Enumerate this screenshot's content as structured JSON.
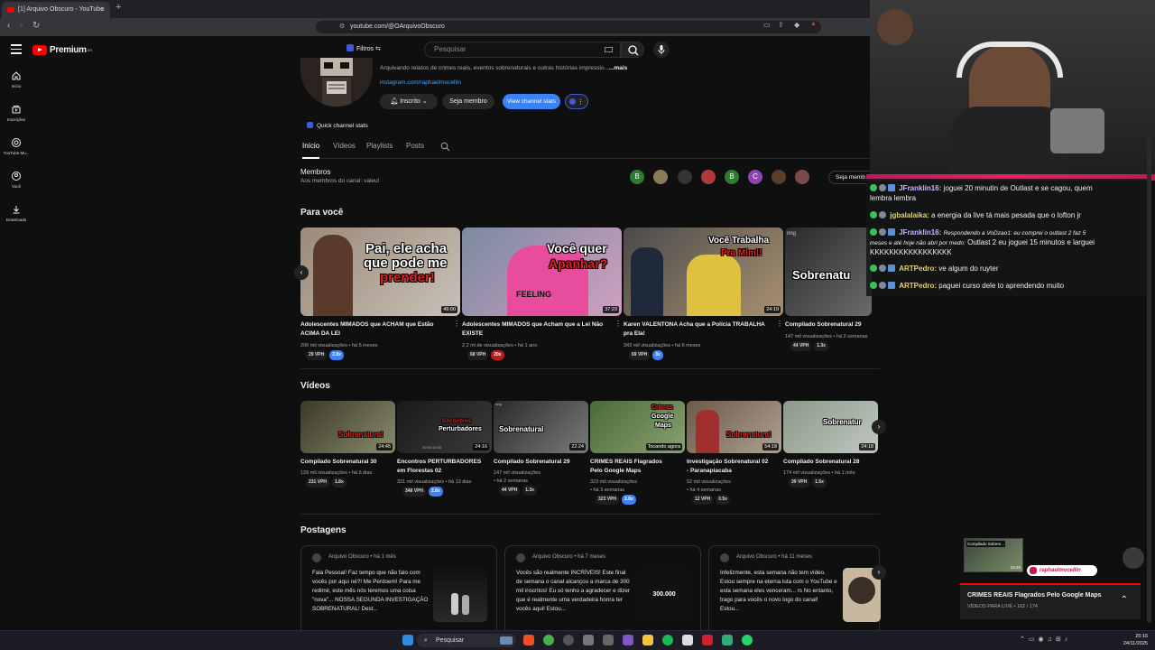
{
  "browser": {
    "tab_title": "[1] Arquivo Obscuro - YouTube",
    "close": "×",
    "new_tab": "+",
    "url": "youtube.com/@OArquivoObscuro"
  },
  "header": {
    "logo": "Premium",
    "logo_sup": "BR",
    "filters_label": "Filtros",
    "search_placeholder": "Pesquisar"
  },
  "sidebar": [
    {
      "label": "Início",
      "icon": "home-icon"
    },
    {
      "label": "Inscrições",
      "icon": "subscriptions-icon"
    },
    {
      "label": "YouTube Mu...",
      "icon": "music-icon"
    },
    {
      "label": "Você",
      "icon": "user-icon"
    },
    {
      "label": "Downloads",
      "icon": "download-icon"
    }
  ],
  "channel": {
    "description": "Arquivando relatos de crimes reais, eventos sobrenaturais e outras histórias impressio...",
    "more": "...mais",
    "link": "instagram.com/raphaelmocellin",
    "subscribed_label": "Inscrito",
    "member_label": "Seja membro",
    "stats_label": "View channel stats",
    "quick_stats": "Quick channel stats",
    "tabs": [
      "Início",
      "Vídeos",
      "Playlists",
      "Posts"
    ]
  },
  "members": {
    "title": "Membros",
    "subtitle": "Aos membros do canal: valeu!",
    "avatars": [
      "B",
      "",
      "",
      "",
      "B",
      "C",
      "",
      ""
    ],
    "button": "Seja memb"
  },
  "for_you": {
    "title": "Para você",
    "videos": [
      {
        "title": "Adolescentes MIMADOS que ACHAM que Estão ACIMA DA LEI",
        "meta": "296 mil visualizações • há 5 meses",
        "duration": "49:00",
        "vph": "29 VPH",
        "mult": "2.8x",
        "mult_color": "blue",
        "thumb_text_1": "Pai, ele acha",
        "thumb_text_2": "que pode me",
        "thumb_text_3": "prender!"
      },
      {
        "title": "Adolescentes MIMADOS que Acham que a Lei Não EXISTE",
        "meta": "2,2 mi de visualizações • há 1 ano",
        "duration": "37:23",
        "vph": "68 VPH",
        "mult": "20x",
        "mult_color": "red",
        "thumb_text_1": "Você quer",
        "thumb_text_2": "Apanhar?",
        "thumb_text_3": "FEELING"
      },
      {
        "title": "Karen VALENTONA Acha que a Polícia TRABALHA pra Ela!",
        "meta": "343 mil visualizações • há 6 meses",
        "duration": "24:19",
        "vph": "69 VPH",
        "mult": "3x",
        "mult_color": "blue",
        "thumb_text_1": "Você Trabalha",
        "thumb_text_2": "Pra Mim!!"
      },
      {
        "title": "Compilado Sobrenatural 29",
        "meta": "147 mil visualizações • há 2 semanas",
        "duration": "",
        "vph": "44 VPH",
        "mult": "1.3x",
        "mult_color": "dark",
        "thumb_text_1": "Sobrenatu",
        "thumb_text_2": "nng"
      }
    ]
  },
  "videos_section": {
    "title": "Vídeos",
    "videos": [
      {
        "title_1": "Compilado Sobrenatural 30",
        "title_2": "",
        "meta_1": "129 mil visualizações • há 6 dias",
        "meta_2": "",
        "duration": "24:45",
        "vph": "231 VPH",
        "mult": "1.8x",
        "mult_color": "dark",
        "thumb_text": "Sobrenatural"
      },
      {
        "title_1": "Encontros PERTURBADORES",
        "title_2": "em Florestas 02",
        "meta_1": "331 mil visualizações • há 13 dias",
        "meta_2": "",
        "duration": "24:16",
        "vph": "348 VPH",
        "mult": "2.8x",
        "mult_color": "blue",
        "thumb_text": "Encontros",
        "thumb_text_2": "Perturbadores",
        "thumb_sub": "00:00:10:05"
      },
      {
        "title_1": "Compilado Sobrenatural 29",
        "title_2": "",
        "meta_1": "147 mil visualizações",
        "meta_2": "• há 2 semanas",
        "duration": "22:24",
        "vph": "44 VPH",
        "mult": "1.3x",
        "mult_color": "dark",
        "thumb_text": "Sobrenatural",
        "thumb_sub": "nng"
      },
      {
        "title_1": "CRIMES REAIS Flagrados",
        "title_2": "Pelo Google Maps",
        "meta_1": "323 mil visualizações",
        "meta_2": "• há 3 semanas",
        "duration": "Tocando agora",
        "vph": "323 VPH",
        "mult": "2.8x",
        "mult_color": "blue",
        "thumb_text": "Crimes",
        "thumb_text_2": "Google",
        "thumb_text_3": "Maps"
      },
      {
        "title_1": "Investigação Sobrenatural 02",
        "title_2": "- Paranapiacaba",
        "meta_1": "52 mil visualizações",
        "meta_2": "• há 4 semanas",
        "duration": "54:18",
        "vph": "12 VPH",
        "mult": "0.5x",
        "mult_color": "dark",
        "thumb_text": "Sobrenatural"
      },
      {
        "title_1": "Compilado Sobrenatural 28",
        "title_2": "",
        "meta_1": "174 mil visualizações • há 1 mês",
        "meta_2": "",
        "duration": "24:18",
        "vph": "39 VPH",
        "mult": "1.5x",
        "mult_color": "dark",
        "thumb_text": "Sobrenatur"
      }
    ]
  },
  "posts": {
    "title": "Postagens",
    "items": [
      {
        "author": "Arquivo Obscuro • há 1 mês",
        "text": "Fala Pessoal! Faz tempo que não falo com vocês por aqui né?! Me Perdoem! Para me redimir, este mês nós teremos uma coisa \"nova\"... NOSSA SEGUNDA INVESTIGAÇÃO SOBRENATURAL! Dest..."
      },
      {
        "author": "Arquivo Obscuro • há 7 meses",
        "text": "Vocês são realmente INCRÍVEIS! Este final de semana o canal alcançou a marca de 300 mil inscritos! Eu só tenho a agradecer e dizer que é realmente uma verdadeira honra ter vocês aqui! Estou...",
        "img_text": "300.000"
      },
      {
        "author": "Arquivo Obscuro • há 11 meses",
        "text": "Infelizmente, esta semana não tem vídeo. Estou sempre na eterna luta com o YouTube e esta semana eles venceram... rs No entanto, trago para vocês o novo logo do canal! Estou..."
      }
    ]
  },
  "chat": {
    "messages": [
      {
        "user": "JFranklin16:",
        "text": "joguei 20 minutin de Outlast e se cagou, quem",
        "cont": "lembra lembra"
      },
      {
        "user": "jgbalalaika:",
        "text": "a energia da live tá mais pesada que o lofton jr"
      },
      {
        "user": "JFranklin16:",
        "reply": "Respondendo a VoDzao1: eu comprei o outlast 2 faz 5",
        "reply2": "meses e até hoje não abri por medo:",
        "text": "Outlast 2 eu joguei 15 minutos e larguei",
        "cont": "KKKKKKKKKKKKKKKKK"
      },
      {
        "user": "ARTPedro:",
        "text": "ve algum do ruyter"
      },
      {
        "user": "ARTPedro:",
        "text": "paguei curso dele to aprendendo muito"
      }
    ]
  },
  "mini_player": {
    "title": "CRIMES REAIS Flagrados Pelo Google Maps",
    "subtitle": "VÍDEOS PARA LIVE • 162 / 174",
    "thumb_label": "Compilado Sobren...",
    "thumb_duration": "24:45",
    "watermark": "raphaelmocellin"
  },
  "taskbar": {
    "search": "Pesquisar",
    "time": "20:16",
    "date": "24/11/2025"
  },
  "colors": {
    "accent_blue": "#3ea6ff",
    "yt_red": "#ff0000",
    "stats_button": "#3b82f6"
  }
}
